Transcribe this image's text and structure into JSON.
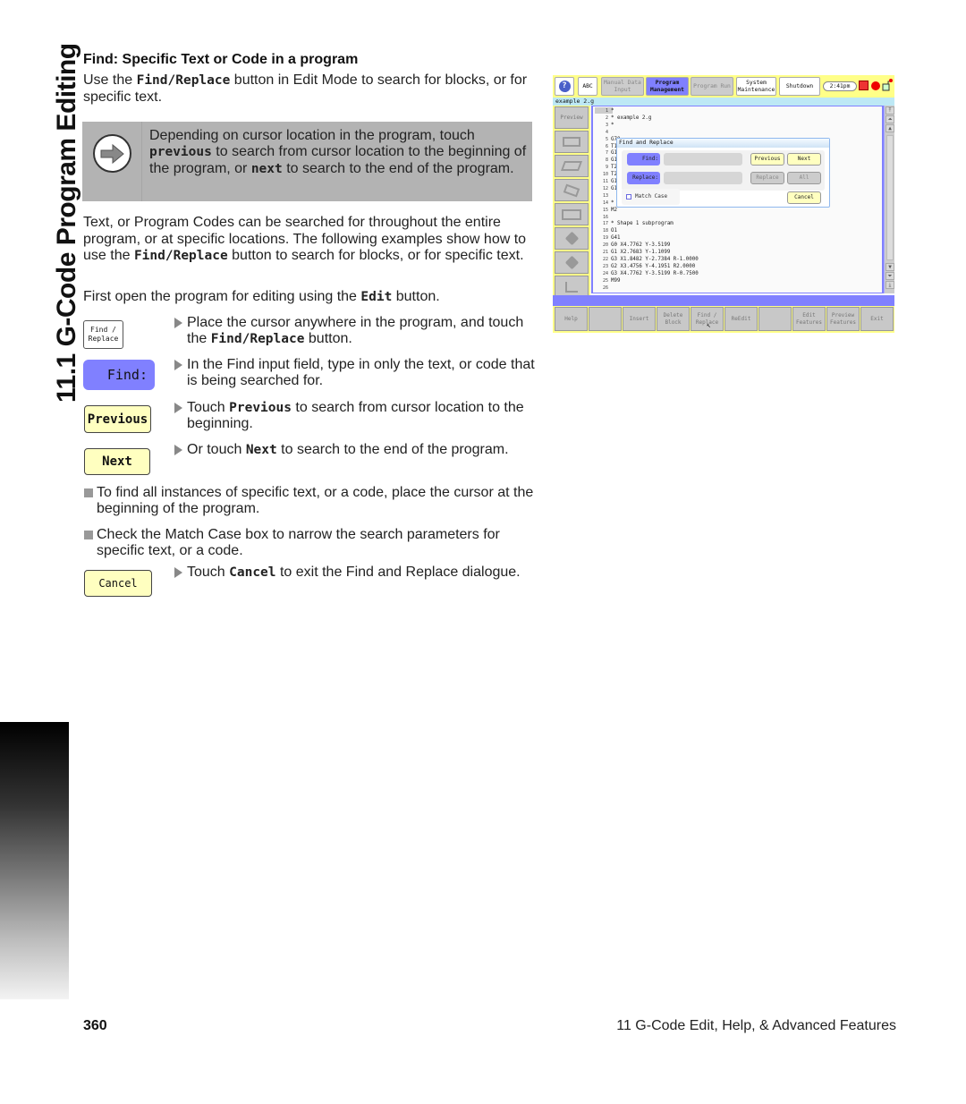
{
  "chapter_tab": "11.1 G-Code Program Editing",
  "section": {
    "heading": "Find: Specific Text or Code in a program",
    "intro": [
      "Use the ",
      "Find/Replace",
      " button in Edit Mode to search for blocks, or for specific text."
    ],
    "note": {
      "icon": "arrow-right-icon",
      "parts": [
        "Depending on cursor location in the program, touch ",
        "previous",
        "  to search from cursor location to the beginning of the program, or ",
        "next",
        " to search to the end of the program."
      ]
    },
    "paragraph": [
      "Text, or Program Codes can be searched for throughout the entire program, or at specific locations.  The following examples show how to use the ",
      "Find/Replace",
      " button to search for blocks, or for specific text."
    ],
    "open_para": [
      "First open the program for editing using the ",
      "Edit",
      " button."
    ]
  },
  "steps": [
    {
      "icon_label_1": "Find /",
      "icon_label_2": "Replace",
      "parts": [
        "Place the cursor anywhere in the program, and touch the ",
        "Find/Replace",
        " button."
      ]
    },
    {
      "icon_label": "Find:",
      "parts": [
        "In the Find input field, type in only the text, or code that is  being searched for."
      ]
    },
    {
      "icon_label": "Previous",
      "parts": [
        "Touch ",
        "Previous",
        " to search from cursor location to the beginning."
      ]
    },
    {
      "icon_label": "Next",
      "parts": [
        "Or touch ",
        "Next",
        " to search to the end of the program."
      ]
    },
    {
      "icon_label": "Cancel",
      "parts": [
        "Touch ",
        "Cancel",
        " to exit the Find and Replace dialogue."
      ]
    }
  ],
  "bullets": [
    "To find all instances of specific text, or a code, place the cursor at the beginning of the program.",
    "Check the Match Case box to narrow the search parameters for specific text, or a code."
  ],
  "screenshot": {
    "topbar": {
      "help": "?",
      "abc": "ABC",
      "manual_data_input": "Manual Data Input",
      "program_management": "Program Management",
      "program_run": "Program Run",
      "system_maintenance": "System Maintenance",
      "shutdown": "Shutdown",
      "clock": "2:41pm"
    },
    "file_title": "example 2.g",
    "sidebar": {
      "preview": "Preview"
    },
    "code_lines": [
      {
        "n": "1",
        "t": "*"
      },
      {
        "n": "2",
        "t": "* example 2.g"
      },
      {
        "n": "3",
        "t": "*"
      },
      {
        "n": "4",
        "t": ""
      },
      {
        "n": "5",
        "t": "G70"
      },
      {
        "n": "6",
        "t": "T1"
      },
      {
        "n": "7",
        "t": "G1"
      },
      {
        "n": "8",
        "t": "G1"
      },
      {
        "n": "9",
        "t": "T2"
      },
      {
        "n": "10",
        "t": "T2"
      },
      {
        "n": "11",
        "t": "G1"
      },
      {
        "n": "12",
        "t": "G1"
      },
      {
        "n": "13",
        "t": ""
      },
      {
        "n": "14",
        "t": "*"
      },
      {
        "n": "15",
        "t": "M2"
      },
      {
        "n": "16",
        "t": ""
      },
      {
        "n": "17",
        "t": "* Shape 1 subprogram"
      },
      {
        "n": "18",
        "t": "O1"
      },
      {
        "n": "19",
        "t": "G41"
      },
      {
        "n": "20",
        "t": "G0 X4.7762 Y-3.5199"
      },
      {
        "n": "21",
        "t": "G1 X2.7683 Y-1.1099"
      },
      {
        "n": "22",
        "t": "G3 X1.8482 Y-2.7384 R-1.0000"
      },
      {
        "n": "23",
        "t": "G2 X3.4756 Y-4.1951 R2.0000"
      },
      {
        "n": "24",
        "t": "G3 X4.7762 Y-3.5199 R-0.7500"
      },
      {
        "n": "25",
        "t": "M99"
      },
      {
        "n": "26",
        "t": ""
      }
    ],
    "dialog": {
      "title": "Find and Replace",
      "find_label": "Find:",
      "find_value": "",
      "replace_label": "Replace:",
      "replace_value": "",
      "previous": "Previous",
      "next": "Next",
      "replace": "Replace",
      "all": "All",
      "match_case": "Match Case",
      "match_case_checked": false,
      "cancel": "Cancel"
    },
    "bottombar": [
      "Help",
      "",
      "Insert",
      "Delete Block",
      "Find / Replace",
      "ReEdit",
      "",
      "Edit Features",
      "Preview Features",
      "Exit"
    ]
  },
  "footer": {
    "page_number": "360",
    "chapter_title": "11 G-Code Edit, Help, & Advanced Features"
  }
}
